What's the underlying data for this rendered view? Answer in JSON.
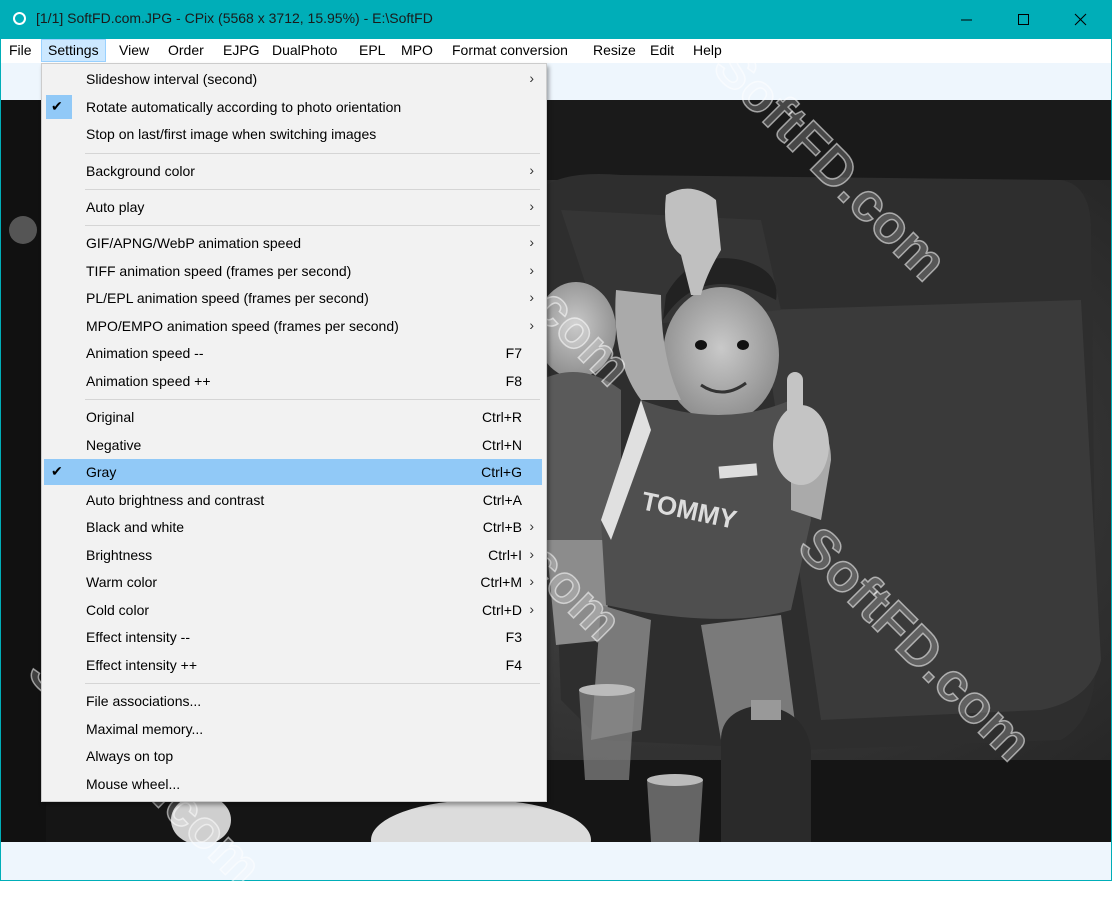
{
  "window": {
    "title": "[1/1] SoftFD.com.JPG - CPix (5568 x 3712, 15.95%) - E:\\SoftFD",
    "accent_color": "#00aeb8"
  },
  "menubar": {
    "items": [
      "File",
      "Settings",
      "View",
      "Order",
      "EJPG",
      "DualPhoto",
      "EPL",
      "MPO",
      "Format conversion",
      "Resize",
      "Edit",
      "Help"
    ],
    "active": "Settings"
  },
  "settings_menu": {
    "items": [
      {
        "label": "Slideshow interval (second)",
        "shortcut": "",
        "submenu": true,
        "checked": false
      },
      {
        "label": "Rotate automatically according to photo orientation",
        "shortcut": "",
        "submenu": false,
        "checked": true
      },
      {
        "label": "Stop on last/first image when switching images",
        "shortcut": "",
        "submenu": false,
        "checked": false
      },
      {
        "label": "Background color",
        "shortcut": "",
        "submenu": true,
        "checked": false
      },
      {
        "label": "Auto play",
        "shortcut": "",
        "submenu": true,
        "checked": false
      },
      {
        "label": "GIF/APNG/WebP animation speed",
        "shortcut": "",
        "submenu": true,
        "checked": false
      },
      {
        "label": "TIFF animation speed (frames per second)",
        "shortcut": "",
        "submenu": true,
        "checked": false
      },
      {
        "label": "PL/EPL animation speed (frames per second)",
        "shortcut": "",
        "submenu": true,
        "checked": false
      },
      {
        "label": "MPO/EMPO animation speed (frames per second)",
        "shortcut": "",
        "submenu": true,
        "checked": false
      },
      {
        "label": "Animation speed --",
        "shortcut": "F7",
        "submenu": false,
        "checked": false
      },
      {
        "label": "Animation speed ++",
        "shortcut": "F8",
        "submenu": false,
        "checked": false
      },
      {
        "label": "Original",
        "shortcut": "Ctrl+R",
        "submenu": false,
        "checked": false
      },
      {
        "label": "Negative",
        "shortcut": "Ctrl+N",
        "submenu": false,
        "checked": false
      },
      {
        "label": "Gray",
        "shortcut": "Ctrl+G",
        "submenu": false,
        "checked": true,
        "highlighted": true
      },
      {
        "label": "Auto brightness and contrast",
        "shortcut": "Ctrl+A",
        "submenu": false,
        "checked": false
      },
      {
        "label": "Black and white",
        "shortcut": "Ctrl+B",
        "submenu": true,
        "checked": false
      },
      {
        "label": "Brightness",
        "shortcut": "Ctrl+I",
        "submenu": true,
        "checked": false
      },
      {
        "label": "Warm color",
        "shortcut": "Ctrl+M",
        "submenu": true,
        "checked": false
      },
      {
        "label": "Cold color",
        "shortcut": "Ctrl+D",
        "submenu": true,
        "checked": false
      },
      {
        "label": "Effect intensity --",
        "shortcut": "F3",
        "submenu": false,
        "checked": false
      },
      {
        "label": "Effect intensity ++",
        "shortcut": "F4",
        "submenu": false,
        "checked": false
      },
      {
        "label": "File associations...",
        "shortcut": "",
        "submenu": false,
        "checked": false
      },
      {
        "label": "Maximal memory...",
        "shortcut": "",
        "submenu": false,
        "checked": false
      },
      {
        "label": "Always on top",
        "shortcut": "",
        "submenu": false,
        "checked": false
      },
      {
        "label": "Mouse wheel...",
        "shortcut": "",
        "submenu": false,
        "checked": false
      }
    ]
  },
  "photo": {
    "shirt_text": "TOMMY"
  },
  "watermark": "SoftFD.com",
  "colors": {
    "menu_bg": "#f2f2f2",
    "menu_highlight": "#91c9f7",
    "menubar_active": "#cce8ff",
    "strip": "#eef6fd"
  }
}
